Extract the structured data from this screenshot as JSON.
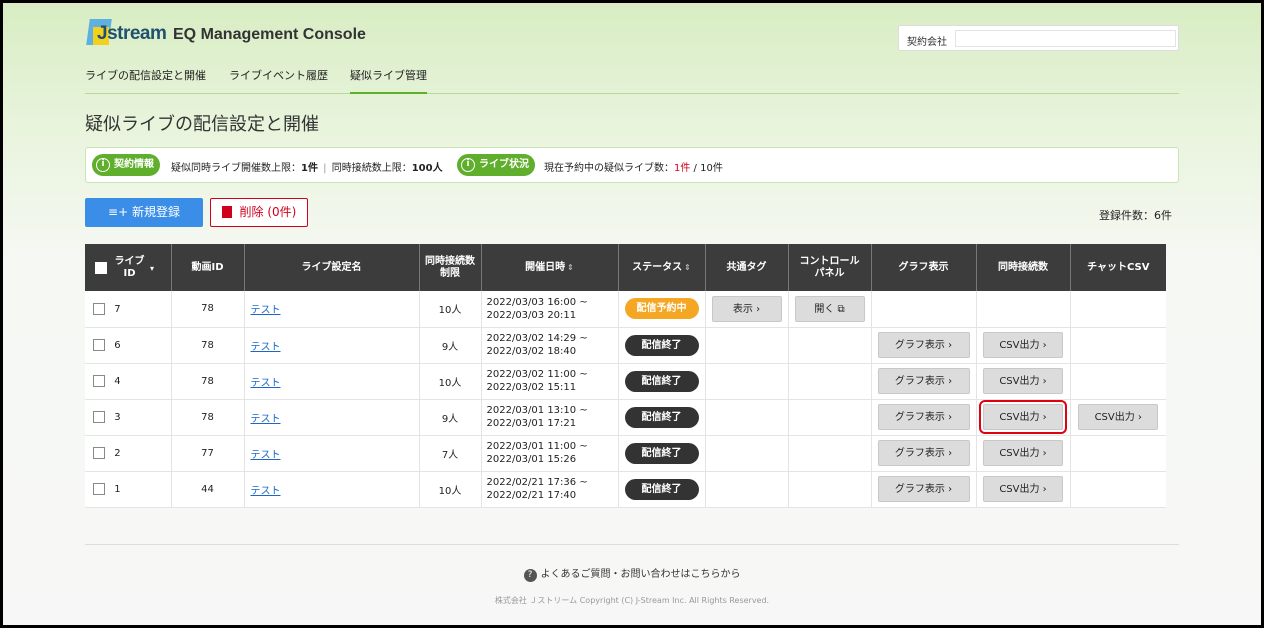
{
  "header": {
    "logo_text": "Jstream",
    "app_title": "EQ Management Console",
    "contract_label": "契約会社",
    "contract_value": ""
  },
  "nav": {
    "items": [
      {
        "label": "ライブの配信設定と開催"
      },
      {
        "label": "ライブイベント履歴"
      },
      {
        "label": "疑似ライブ管理"
      }
    ],
    "active_index": 2
  },
  "page_title": "疑似ライブの配信設定と開催",
  "info": {
    "contract_pill": "契約情報",
    "contract_text_1": "疑似同時ライブ開催数上限：",
    "contract_value_1": "1件",
    "separator": "|",
    "contract_text_2": "同時接続数上限：",
    "contract_value_2": "100人",
    "status_pill": "ライブ状況",
    "status_text": "現在予約中の疑似ライブ数：",
    "status_current": "1件",
    "status_total": " / 10件"
  },
  "actions": {
    "new_label": "新規登録",
    "delete_label": "削除 (0件)",
    "count_label": "登録件数：6件"
  },
  "table": {
    "headers": {
      "live_id_1": "ライブ",
      "live_id_2": "ID",
      "video_id": "動画ID",
      "name": "ライブ設定名",
      "limit_1": "同時接続数",
      "limit_2": "制限",
      "datetime": "開催日時",
      "status": "ステータス",
      "tag": "共通タグ",
      "control_1": "コントロール",
      "control_2": "パネル",
      "graph": "グラフ表示",
      "concurrent": "同時接続数",
      "chat": "チャットCSV"
    },
    "rows": [
      {
        "id": "7",
        "video_id": "78",
        "name": "テスト",
        "limit": "10人",
        "start": "2022/03/03 16:00 ~",
        "end": "2022/03/03 20:11",
        "status": "配信予約中",
        "status_type": "scheduled",
        "tag_btn": "表示 ›",
        "control_btn": "開く ⧉",
        "graph_btn": "",
        "csv_btn": "",
        "chat_btn": ""
      },
      {
        "id": "6",
        "video_id": "78",
        "name": "テスト",
        "limit": "9人",
        "start": "2022/03/02 14:29 ~",
        "end": "2022/03/02 18:40",
        "status": "配信終了",
        "status_type": "ended",
        "tag_btn": "",
        "control_btn": "",
        "graph_btn": "グラフ表示 ›",
        "csv_btn": "CSV出力 ›",
        "chat_btn": ""
      },
      {
        "id": "4",
        "video_id": "78",
        "name": "テスト",
        "limit": "10人",
        "start": "2022/03/02 11:00 ~",
        "end": "2022/03/02 15:11",
        "status": "配信終了",
        "status_type": "ended",
        "tag_btn": "",
        "control_btn": "",
        "graph_btn": "グラフ表示 ›",
        "csv_btn": "CSV出力 ›",
        "chat_btn": ""
      },
      {
        "id": "3",
        "video_id": "78",
        "name": "テスト",
        "limit": "9人",
        "start": "2022/03/01 13:10 ~",
        "end": "2022/03/01 17:21",
        "status": "配信終了",
        "status_type": "ended",
        "tag_btn": "",
        "control_btn": "",
        "graph_btn": "グラフ表示 ›",
        "csv_btn": "CSV出力 ›",
        "chat_btn": "CSV出力 ›"
      },
      {
        "id": "2",
        "video_id": "77",
        "name": "テスト",
        "limit": "7人",
        "start": "2022/03/01 11:00 ~",
        "end": "2022/03/01 15:26",
        "status": "配信終了",
        "status_type": "ended",
        "tag_btn": "",
        "control_btn": "",
        "graph_btn": "グラフ表示 ›",
        "csv_btn": "CSV出力 ›",
        "chat_btn": ""
      },
      {
        "id": "1",
        "video_id": "44",
        "name": "テスト",
        "limit": "10人",
        "start": "2022/02/21 17:36 ~",
        "end": "2022/02/21 17:40",
        "status": "配信終了",
        "status_type": "ended",
        "tag_btn": "",
        "control_btn": "",
        "graph_btn": "グラフ表示 ›",
        "csv_btn": "CSV出力 ›",
        "chat_btn": ""
      }
    ]
  },
  "footer": {
    "faq": "よくあるご質問・お問い合わせはこちらから",
    "copyright": "株式会社 Ｊストリーム Copyright (C) J-Stream Inc. All Rights Reserved."
  },
  "colors": {
    "accent_green": "#5fae2c",
    "primary_blue": "#3b8ee8",
    "danger_red": "#d0021b",
    "scheduled_orange": "#f5a623"
  }
}
